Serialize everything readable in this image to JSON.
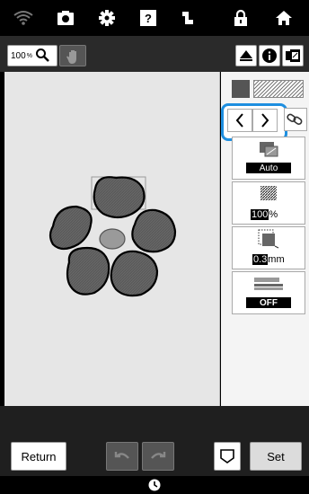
{
  "status_bar": {
    "icons": [
      "wifi-icon",
      "camera-icon",
      "settings-icon",
      "help-icon",
      "needle-icon",
      "lock-icon",
      "home-icon"
    ],
    "help_glyph": "?"
  },
  "toolbar": {
    "zoom_value": "100",
    "zoom_unit": "%",
    "icons": [
      "magnifier-icon",
      "hand-icon",
      "eject-icon",
      "info-icon",
      "card-icon"
    ]
  },
  "panel": {
    "fill_type": "Auto",
    "density_value": "100",
    "density_unit": "%",
    "offset_value": "0.3",
    "offset_unit": "mm",
    "underlay_state": "OFF"
  },
  "bottom": {
    "return_label": "Return",
    "set_label": "Set"
  },
  "colors": {
    "highlight": "#1e8fe0",
    "petal_fill": "#5b5b5b",
    "canvas": "#e6e6e6"
  }
}
